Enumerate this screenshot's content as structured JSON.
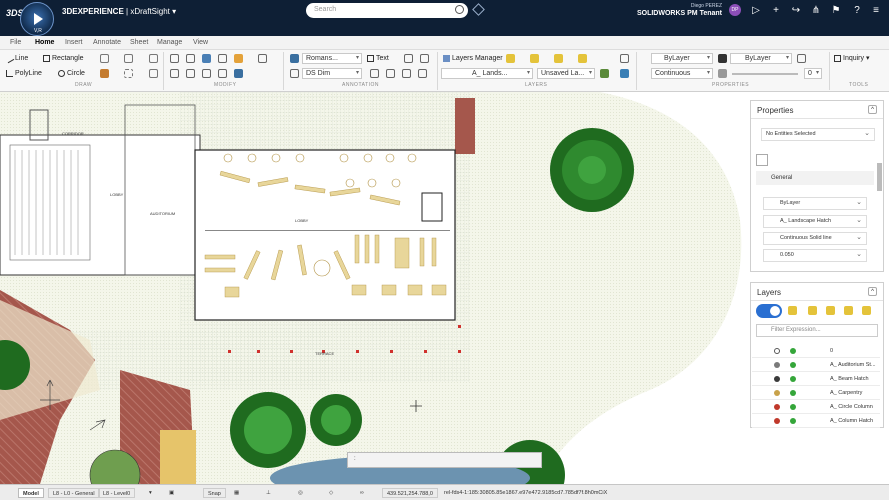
{
  "topbar": {
    "brand_short": "3DS",
    "compass_version": "V,R",
    "app_name": "3DEXPERIENCE",
    "app_sub": "xDraftSight",
    "search_placeholder": "Search",
    "user_name": "Diego PEREZ",
    "tenant": "SOLIDWORKS PM Tenant",
    "avatar_initials": "DP"
  },
  "menu": {
    "items": [
      "File",
      "Home",
      "Insert",
      "Annotate",
      "Sheet",
      "Manage",
      "View"
    ],
    "active": "Home"
  },
  "ribbon": {
    "draw": {
      "line": "Line",
      "rectangle": "Rectangle",
      "polyline": "PolyLine",
      "circle": "Circle",
      "group_label": "DRAW"
    },
    "modify": {
      "group_label": "MODIFY"
    },
    "annotation": {
      "text_style": "Romans...",
      "text": "Text",
      "dim_style": "DS Dim",
      "group_label": "ANNOTATION"
    },
    "layers": {
      "manager": "Layers Manager",
      "current_layer": "A_ Lands...",
      "state": "Unsaved La...",
      "group_label": "LAYERS"
    },
    "properties": {
      "color": "ByLayer",
      "linestyle": "Continuous",
      "lineweight": "ByLayer",
      "transparency": "0",
      "group_label": "PROPERTIES"
    },
    "tools": {
      "inquiry": "Inquiry",
      "group_label": "TOOLS"
    }
  },
  "canvas": {
    "labels": {
      "corridor": "CORRIDOR",
      "lobby": "LOBBY",
      "auditorium": "AUDITORIUM",
      "lobby2": "LOBBY",
      "terrace": "TERRACE"
    }
  },
  "properties_panel": {
    "title": "Properties",
    "selection": "No Entities Selected",
    "section": "General",
    "rows": [
      "ByLayer",
      "A_ Landscape Hatch",
      "Continuous Solid line",
      "0.050"
    ]
  },
  "layers_panel": {
    "title": "Layers",
    "filter_placeholder": "Filter Expression...",
    "rows": [
      {
        "name": "0",
        "color": "#ffffff"
      },
      {
        "name": "A_ Auditorium St...",
        "color": "#7a7a7a"
      },
      {
        "name": "A_ Beam Hatch",
        "color": "#3a3a3a"
      },
      {
        "name": "A_ Carpentry",
        "color": "#c8a24a"
      },
      {
        "name": "A_ Circle Column",
        "color": "#c0392b"
      },
      {
        "name": "A_ Column Hatch",
        "color": "#c0392b"
      }
    ]
  },
  "command": {
    "prompt": ":"
  },
  "status": {
    "tabs": [
      "Model",
      "L8 - L0 - General",
      "L8 - Level0"
    ],
    "snap": "Snap",
    "coords": "439.521,254.788,0",
    "file_ref": "rel-fds4-1:185:30805.85e1867.e97e472.9185cd7.785df7f.8h0mCiX"
  }
}
